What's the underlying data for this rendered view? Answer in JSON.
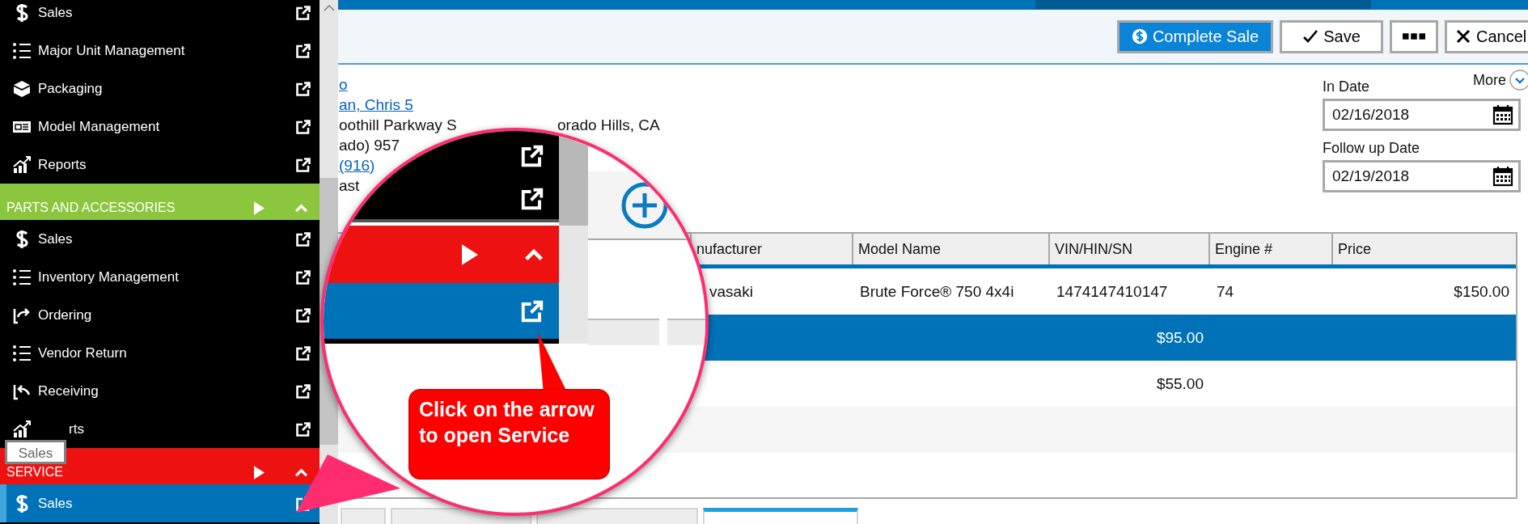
{
  "sidebar": {
    "items": [
      {
        "kind": "item",
        "label": "Sales",
        "selected": false,
        "covered": false
      },
      {
        "kind": "item",
        "label": "Major Unit Management",
        "selected": false,
        "covered": false
      },
      {
        "kind": "item",
        "label": "Packaging",
        "selected": false,
        "covered": false
      },
      {
        "kind": "item",
        "label": "Model Management",
        "selected": false,
        "covered": false
      },
      {
        "kind": "item",
        "label": "Reports",
        "selected": false,
        "covered": false
      },
      {
        "kind": "header",
        "label": "PARTS AND ACCESSORIES",
        "color": "#8cc63f"
      },
      {
        "kind": "item",
        "label": "Sales",
        "selected": false,
        "covered": false
      },
      {
        "kind": "item",
        "label": "Inventory Management",
        "selected": false,
        "covered": false
      },
      {
        "kind": "item",
        "label": "Ordering",
        "selected": false,
        "covered": false
      },
      {
        "kind": "item",
        "label": "Vendor Return",
        "selected": false,
        "covered": false
      },
      {
        "kind": "item",
        "label": "Receiving",
        "selected": false,
        "covered": false
      },
      {
        "kind": "item",
        "label": "rts",
        "selected": false,
        "covered": true
      },
      {
        "kind": "header",
        "label": "SERVICE",
        "color": "#ee1111"
      },
      {
        "kind": "item",
        "label": "Sales",
        "selected": true,
        "covered": false
      }
    ]
  },
  "tooltip": {
    "text": "Sales"
  },
  "toolbar": {
    "buttons": [
      {
        "kind": "primary",
        "label": "Complete Sale"
      },
      {
        "kind": "save",
        "label": "Save"
      },
      {
        "kind": "more"
      },
      {
        "kind": "cancel",
        "label": "Cancel"
      }
    ]
  },
  "customer": {
    "lines": [
      {
        "kind": "link",
        "parts": [
          "o"
        ]
      },
      {
        "kind": "link",
        "parts": [
          "an, Chris 5"
        ]
      },
      {
        "kind": "text",
        "parts": [
          "oothill Parkway S",
          "orado Hills, CA"
        ]
      },
      {
        "kind": "text",
        "parts": [
          "ado) 957"
        ]
      },
      {
        "kind": "link",
        "parts": [
          "(916)"
        ]
      },
      {
        "kind": "text",
        "parts": [
          "ast"
        ]
      }
    ]
  },
  "dates": {
    "more": "More",
    "fields": [
      {
        "label": "In Date",
        "value": "02/16/2018"
      },
      {
        "label": "Follow up Date",
        "value": "02/19/2018"
      }
    ]
  },
  "table": {
    "columns": [
      "nufacturer",
      "Model Name",
      "VIN/HIN/SN",
      "Engine #",
      "Price"
    ],
    "rows": [
      {
        "kind": "unit",
        "selected": false,
        "column_1": "vasaki",
        "model_name": "Brute Force® 750 4x4i",
        "vin_hin_sn": "1474147410147",
        "engine": "74",
        "price": "$150.00"
      },
      {
        "kind": "line",
        "selected": true,
        "vin_hin_sn": "$95.00"
      },
      {
        "kind": "line",
        "selected": false,
        "vin_hin_sn": "$55.00"
      },
      {
        "kind": "blank",
        "selected": false
      },
      {
        "kind": "blank",
        "selected": false
      }
    ]
  },
  "bottom_tabs": [
    {
      "selected": false
    },
    {
      "selected": false
    },
    {
      "selected": false
    },
    {
      "selected": true
    }
  ],
  "magnifier": {
    "callout": "Click on the arrow to open Service"
  }
}
